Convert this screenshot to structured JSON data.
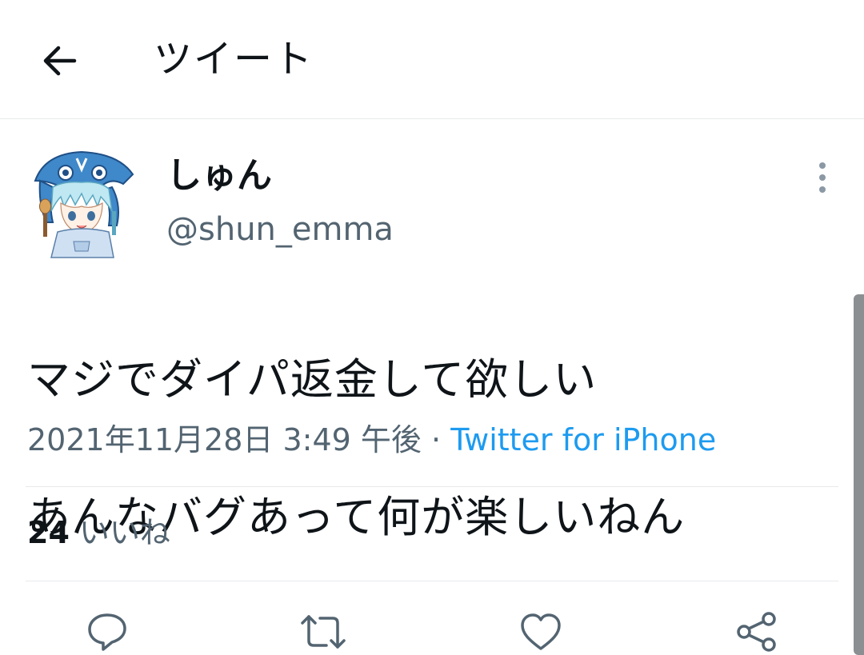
{
  "header": {
    "title": "ツイート",
    "back_icon": "arrow-left-icon"
  },
  "tweet": {
    "display_name": "しゅん",
    "handle": "@shun_emma",
    "lines": [
      "マジでダイパ返金して欲しい",
      "あんなバグあって何が楽しいねん"
    ],
    "timestamp": "2021年11月28日 3:49 午後",
    "separator": "·",
    "source": "Twitter for iPhone"
  },
  "stats": {
    "likes_count": "24",
    "likes_label": "いいね"
  },
  "actions": [
    "reply-icon",
    "retweet-icon",
    "like-icon",
    "share-icon"
  ],
  "colors": {
    "accent": "#1d9bf0",
    "secondary_text": "#536471",
    "divider": "#e6e9eb",
    "icon": "#536471"
  }
}
